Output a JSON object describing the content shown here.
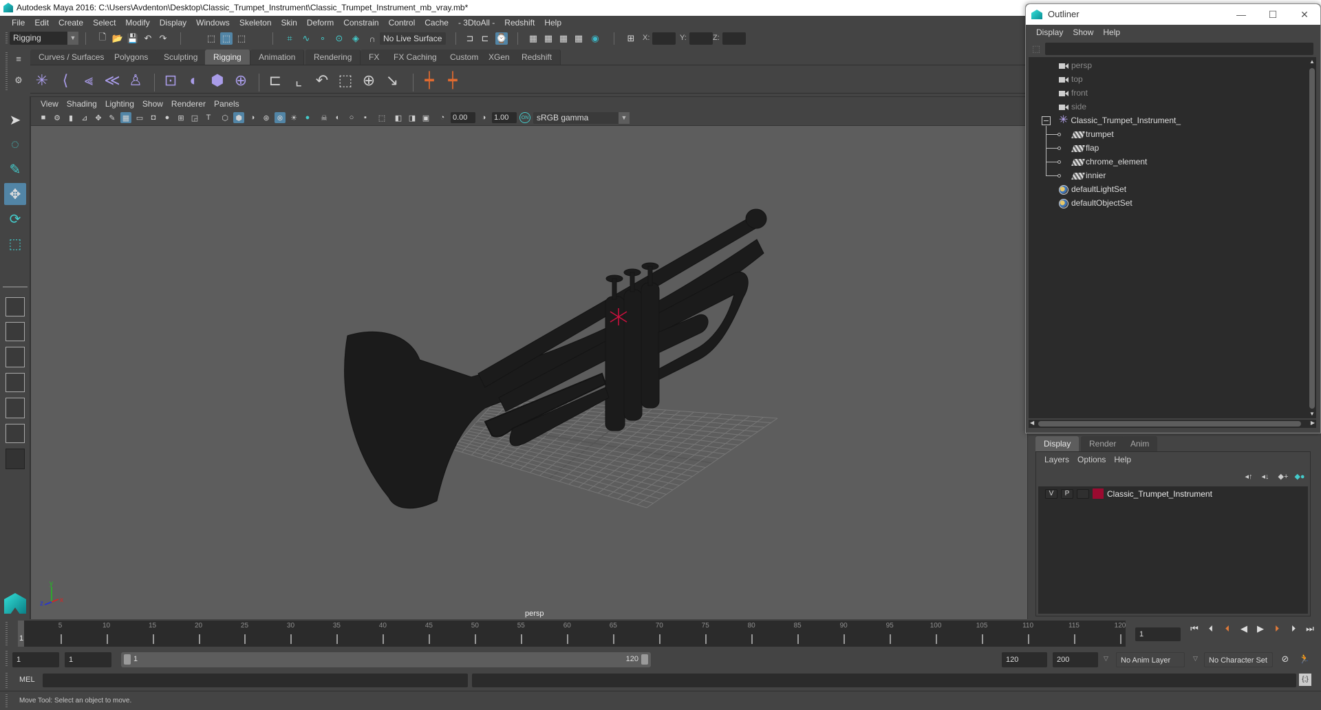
{
  "window": {
    "title": "Autodesk Maya 2016: C:\\Users\\Avdenton\\Desktop\\Classic_Trumpet_Instrument\\Classic_Trumpet_Instrument_mb_vray.mb*"
  },
  "menubar": [
    "File",
    "Edit",
    "Create",
    "Select",
    "Modify",
    "Display",
    "Windows",
    "Skeleton",
    "Skin",
    "Deform",
    "Constrain",
    "Control",
    "Cache",
    "- 3DtoAll -",
    "Redshift",
    "Help"
  ],
  "statusline": {
    "menuset": "Rigging",
    "live_surface": "No Live Surface",
    "x_label": "X:",
    "y_label": "Y:",
    "z_label": "Z:",
    "x_value": "",
    "y_value": "",
    "z_value": ""
  },
  "shelf": {
    "tabs": [
      "Curves / Surfaces",
      "Polygons",
      "Sculpting",
      "Rigging",
      "Animation",
      "Rendering",
      "FX",
      "FX Caching",
      "Custom",
      "XGen",
      "Redshift"
    ],
    "active_tab": "Rigging",
    "icons": [
      "joint-tool",
      "ik-handle",
      "ik-spline-handle",
      "insert-joint",
      "humanik",
      "paint-skin-weights",
      "smooth-bind",
      "lattice",
      "cluster",
      "parent-constraint",
      "point-constraint",
      "orient-constraint",
      "scale-constraint",
      "aim-constraint",
      "pole-vector-constraint",
      "add-influence",
      "remove-influence"
    ]
  },
  "toolbox": {
    "tools": [
      "select-tool",
      "lasso-tool",
      "paint-select-tool",
      "move-tool",
      "rotate-tool",
      "scale-tool"
    ],
    "active_tool": "move-tool"
  },
  "viewport": {
    "menu": [
      "View",
      "Shading",
      "Lighting",
      "Show",
      "Renderer",
      "Panels"
    ],
    "exposure": "0.00",
    "gamma": "1.00",
    "color_space": "sRGB gamma",
    "camera_label": "persp",
    "axis": {
      "x": "x",
      "y": "y",
      "z": "z"
    },
    "colors": {
      "background": "#5d5d5d",
      "model": "#1a1a1a",
      "grid": "#7a7a7a",
      "pivot": "#d01040"
    }
  },
  "outliner": {
    "title": "Outliner",
    "menu": [
      "Display",
      "Show",
      "Help"
    ],
    "filter_value": "",
    "items": [
      {
        "label": "persp",
        "type": "camera",
        "dim": true
      },
      {
        "label": "top",
        "type": "camera",
        "dim": true
      },
      {
        "label": "front",
        "type": "camera",
        "dim": true
      },
      {
        "label": "side",
        "type": "camera",
        "dim": true
      },
      {
        "label": "Classic_Trumpet_Instrument_",
        "type": "group",
        "expanded": true
      },
      {
        "label": "trumpet",
        "type": "mesh",
        "child": true
      },
      {
        "label": "flap",
        "type": "mesh",
        "child": true
      },
      {
        "label": "chrome_element",
        "type": "mesh",
        "child": true
      },
      {
        "label": "innier",
        "type": "mesh",
        "child": true
      },
      {
        "label": "defaultLightSet",
        "type": "set"
      },
      {
        "label": "defaultObjectSet",
        "type": "set"
      }
    ]
  },
  "layer_editor": {
    "tabs": [
      "Display",
      "Render",
      "Anim"
    ],
    "active_tab": "Display",
    "menu": [
      "Layers",
      "Options",
      "Help"
    ],
    "layers": [
      {
        "visible": "V",
        "playback": "P",
        "ref": "",
        "color": "#9b0a30",
        "name": "Classic_Trumpet_Instrument"
      }
    ]
  },
  "timeline": {
    "ticks": [
      5,
      10,
      15,
      20,
      25,
      30,
      35,
      40,
      45,
      50,
      55,
      60,
      65,
      70,
      75,
      80,
      85,
      90,
      95,
      100,
      105,
      110,
      115,
      120
    ],
    "min": 1,
    "max": 120,
    "current_frame_label": "1",
    "current_frame_field": "1"
  },
  "range": {
    "start_time": "1",
    "playback_start": "1",
    "range_start_label": "1",
    "range_end_label": "120",
    "playback_end": "120",
    "end_time": "200",
    "anim_layer": "No Anim Layer",
    "character_set": "No Character Set"
  },
  "cmdline": {
    "label": "MEL",
    "value": "",
    "result": ""
  },
  "helpline": {
    "text": "Move Tool: Select an object to move."
  }
}
